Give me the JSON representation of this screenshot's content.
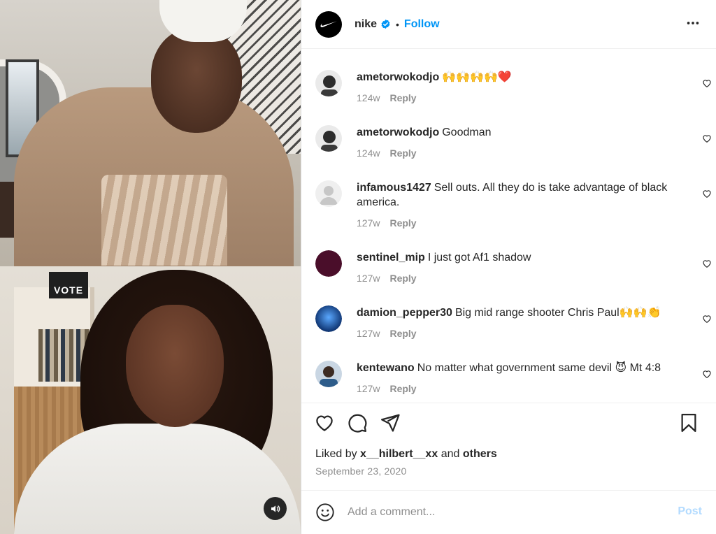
{
  "header": {
    "username": "nike",
    "verified": true,
    "separator": "•",
    "follow_label": "Follow"
  },
  "media": {
    "sign_text": "VOTE",
    "audio_icon": "speaker-icon"
  },
  "comments": [
    {
      "username": "ametorwokodjo",
      "text": "🙌🙌🙌🙌❤️",
      "age": "124w",
      "reply_label": "Reply",
      "avatar_color": "#9a9a9a"
    },
    {
      "username": "ametorwokodjo",
      "text": "Goodman",
      "age": "124w",
      "reply_label": "Reply",
      "avatar_color": "#9a9a9a"
    },
    {
      "username": "infamous1427",
      "text": "Sell outs. All they do is take advantage of black america.",
      "age": "127w",
      "reply_label": "Reply",
      "avatar_color": "#dbdbdb"
    },
    {
      "username": "sentinel_mip",
      "text": "I just got Af1 shadow",
      "age": "127w",
      "reply_label": "Reply",
      "avatar_color": "#4a0e2a"
    },
    {
      "username": "damion_pepper30",
      "text": "Big mid range shooter Chris Paul🙌🙌👏",
      "age": "127w",
      "reply_label": "Reply",
      "avatar_color": "#1f64b8"
    },
    {
      "username": "kentewano",
      "text": "No matter what government same devil 😈 Mt 4:8",
      "age": "127w",
      "reply_label": "Reply",
      "avatar_color": "#6e86a0"
    }
  ],
  "actions": {
    "like_icon": "heart-icon",
    "comment_icon": "comment-bubble-icon",
    "share_icon": "paper-plane-icon",
    "save_icon": "bookmark-icon"
  },
  "likes": {
    "prefix": "Liked by",
    "user": "x__hilbert__xx",
    "and": "and",
    "others": "others"
  },
  "date": "September 23, 2020",
  "add_comment": {
    "placeholder": "Add a comment...",
    "post_label": "Post"
  },
  "colors": {
    "accent": "#0095f6",
    "post_disabled": "#b3dbff",
    "muted": "#8e8e8e",
    "text": "#262626"
  }
}
